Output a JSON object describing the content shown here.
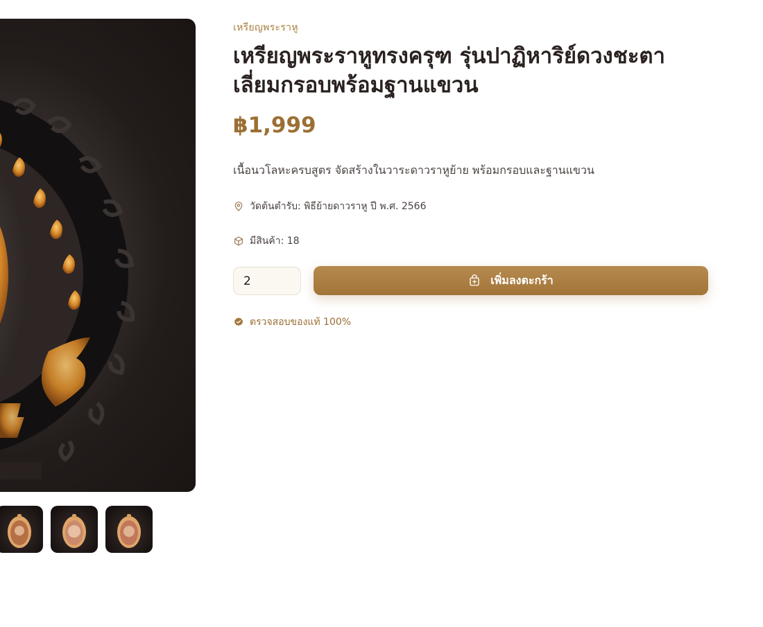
{
  "product": {
    "category": "เหรียญพระราหู",
    "title": "เหรียญพระราหูทรงครุฑ รุ่นปาฏิหาริย์ดวงชะตา เลี่ยมกรอบพร้อมฐานแขวน",
    "price": "฿1,999",
    "description": "เนื้อนวโลหะครบสูตร จัดสร้างในวาระดาวราหูย้าย พร้อมกรอบและฐานแขวน",
    "temple": "วัดต้นตำรับ: พิธีย้ายดาวราหู ปี พ.ศ. 2566",
    "stock": "มีสินค้า: 18",
    "verified": "ตรวจสอบของแท้ 100%"
  },
  "cart": {
    "quantity": "2",
    "add_label": "เพิ่มลงตะกร้า"
  },
  "gallery": {
    "thumbnail_count": 3
  },
  "icons": {
    "temple": "map-pin-icon",
    "stock": "box-icon",
    "cart": "shopping-bag-plus-icon",
    "verified": "badge-check-icon"
  },
  "colors": {
    "accent": "#a27438",
    "price": "#9c6f34",
    "category": "#a8803f"
  }
}
